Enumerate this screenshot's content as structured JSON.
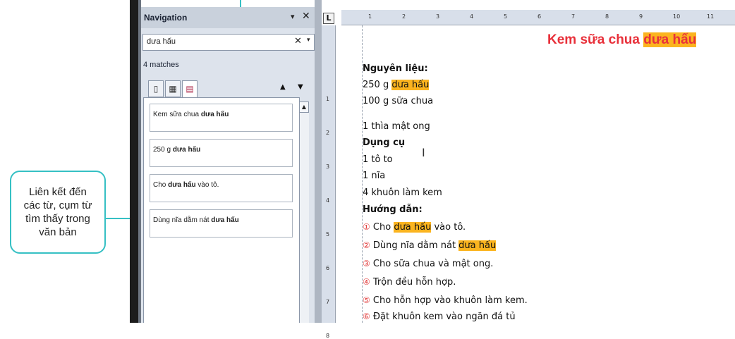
{
  "callout": {
    "text": "Liên kết đến\ncác từ, cụm từ\ntìm thấy trong\nvăn bản"
  },
  "nav": {
    "title": "Navigation",
    "menu_icon": "▾",
    "close_icon": "✕",
    "search_value": "dưa hấu",
    "clear_icon": "✕",
    "dropdown_icon": "▾",
    "match_count": "4 matches",
    "tabs": [
      "▯",
      "▦",
      "▤"
    ],
    "prev_icon": "▲",
    "next_icon": "▼",
    "results": [
      {
        "before": "Kem sữa chua ",
        "match": "dưa hấu",
        "after": ""
      },
      {
        "before": "250 g ",
        "match": "dưa hấu",
        "after": ""
      },
      {
        "before": "Cho ",
        "match": "dưa hấu",
        "after": " vào tô."
      },
      {
        "before": "Dùng nĩa dằm nát ",
        "match": "dưa hấu",
        "after": ""
      }
    ]
  },
  "ruler": {
    "corner": "L",
    "ticks": [
      "1",
      "2",
      "3",
      "4",
      "5",
      "6",
      "7",
      "8",
      "9",
      "10",
      "11"
    ],
    "vticks": [
      "1",
      "2",
      "3",
      "4",
      "5",
      "6",
      "7",
      "8"
    ]
  },
  "doc": {
    "title_before": "Kem sữa chua ",
    "title_match": "dưa hấu",
    "heading_ingredients": "Nguyên liệu:",
    "ing1_before": "250 g ",
    "ing1_match": "dưa hấu",
    "ing2": "100 g sữa chua",
    "ing3": "1 thìa mật ong",
    "heading_tools": "Dụng cụ",
    "tool1": "1 tô to",
    "tool2": "1 nĩa",
    "tool3": "4 khuôn làm kem",
    "heading_steps": "Hướng dẫn:",
    "steps": [
      {
        "num": "①",
        "before": " Cho ",
        "match": "dưa hấu",
        "after": " vào tô."
      },
      {
        "num": "②",
        "before": " Dùng nĩa dằm nát ",
        "match": "dưa hấu",
        "after": ""
      },
      {
        "num": "③",
        "before": " Cho sữa chua và mật ong.",
        "match": "",
        "after": ""
      },
      {
        "num": "④",
        "before": " Trộn đều hỗn hợp.",
        "match": "",
        "after": ""
      },
      {
        "num": "⑤",
        "before": " Cho hỗn hợp vào khuôn làm kem.",
        "match": "",
        "after": ""
      },
      {
        "num": "⑥",
        "before": " Đặt khuôn kem vào ngăn đá tủ",
        "match": "",
        "after": ""
      }
    ]
  },
  "colors": {
    "accent": "#36c0c4",
    "highlight": "#fbb41f",
    "title": "#e8303a"
  }
}
